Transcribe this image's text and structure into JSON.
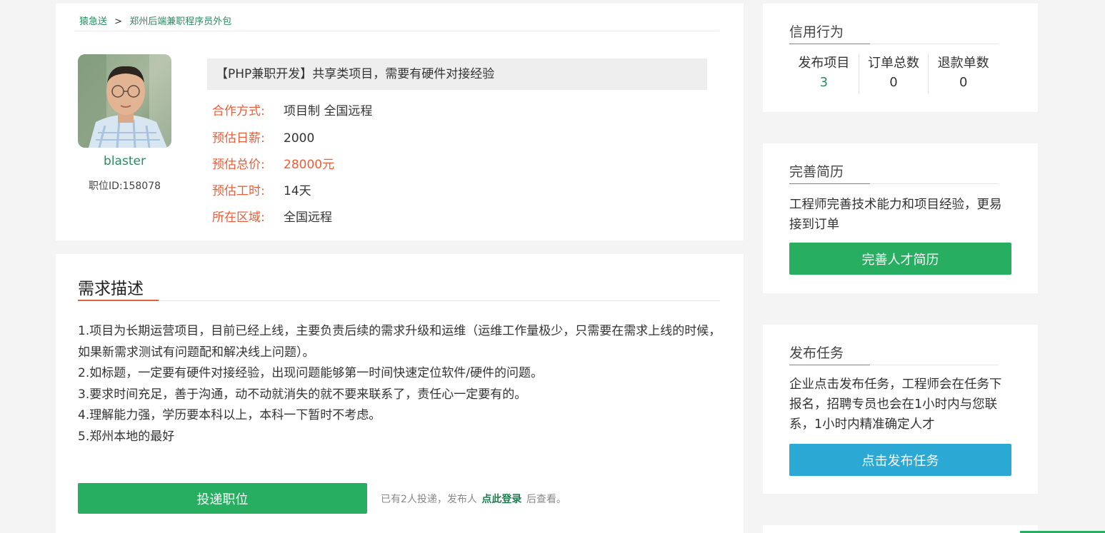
{
  "breadcrumb": {
    "home": "猿急送",
    "separator": ">",
    "current": "郑州后端兼职程序员外包"
  },
  "profile": {
    "username": "blaster",
    "job_id": "职位ID:158078"
  },
  "job": {
    "title": "【PHP兼职开发】共享类项目，需要有硬件对接经验",
    "fields": [
      {
        "label": "合作方式:",
        "value": "项目制 全国远程"
      },
      {
        "label": "预估日薪:",
        "value": "2000"
      },
      {
        "label": "预估总价:",
        "value": "28000元"
      },
      {
        "label": "预估工时:",
        "value": "14天"
      },
      {
        "label": "所在区域:",
        "value": "全国远程"
      }
    ]
  },
  "description": {
    "title": "需求描述",
    "lines": [
      "1.项目为长期运营项目，目前已经上线，主要负责后续的需求升级和运维（运维工作量极少，只需要在需求上线的时候，如果新需求测试有问题配和解决线上问题）。",
      "2.如标题，一定要有硬件对接经验，出现问题能够第一时间快速定位软件/硬件的问题。",
      "3.要求时间充足，善于沟通，动不动就消失的就不要来联系了，责任心一定要有的。",
      "4.理解能力强，学历要本科以上，本科一下暂时不考虑。",
      "5.郑州本地的最好"
    ]
  },
  "apply": {
    "button_label": "投递职位",
    "note_prefix": "已有2人投递，发布人",
    "note_link": "点此登录",
    "note_suffix": "后查看。"
  },
  "credit": {
    "title": "信用行为",
    "stats": [
      {
        "label": "发布项目",
        "value": "3"
      },
      {
        "label": "订单总数",
        "value": "0"
      },
      {
        "label": "退款单数",
        "value": "0"
      }
    ]
  },
  "resume": {
    "title": "完善简历",
    "text": "工程师完善技术能力和项目经验，更易接到订单",
    "button_label": "完善人才简历"
  },
  "publish": {
    "title": "发布任务",
    "text": "企业点击发布任务，工程师会在任务下报名，招聘专员也会在1小时内与您联系，1小时内精准确定人才",
    "button_label": "点击发布任务"
  },
  "colors": {
    "accent_green": "#27ae60",
    "link_green": "#2b8a5f",
    "label_orange": "#e85f3b",
    "button_blue": "#2ba8d4"
  }
}
